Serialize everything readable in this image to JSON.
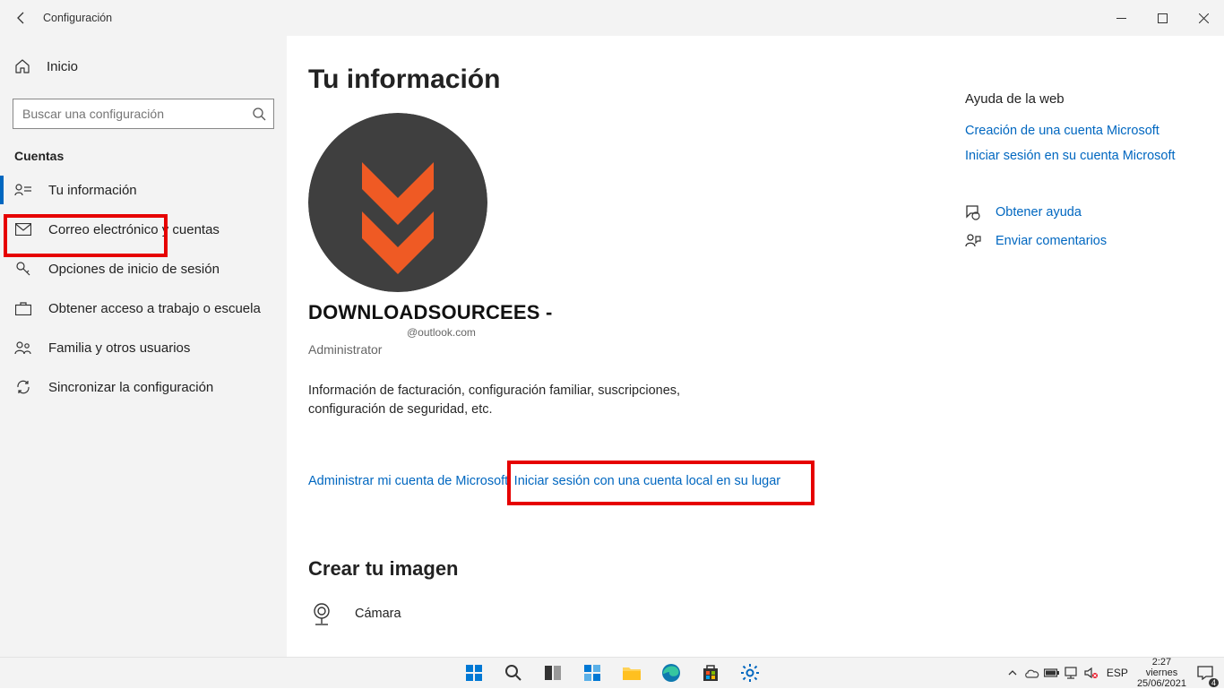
{
  "titlebar": {
    "title": "Configuración"
  },
  "sidebar": {
    "home": "Inicio",
    "search_placeholder": "Buscar una configuración",
    "section": "Cuentas",
    "items": [
      {
        "label": "Tu información"
      },
      {
        "label": "Correo electrónico y cuentas"
      },
      {
        "label": "Opciones de inicio de sesión"
      },
      {
        "label": "Obtener acceso a trabajo o escuela"
      },
      {
        "label": "Familia y otros usuarios"
      },
      {
        "label": "Sincronizar la configuración"
      }
    ]
  },
  "main": {
    "title": "Tu información",
    "account_name": "DOWNLOADSOURCEES -",
    "account_email": "@outlook.com",
    "account_role": "Administrator",
    "desc": "Información de facturación, configuración familiar, suscripciones, configuración de seguridad, etc.",
    "manage_link": "Administrar mi cuenta de Microsoft",
    "local_link": "Iniciar sesión con una cuenta local en su lugar",
    "create_image": "Crear tu imagen",
    "camera": "Cámara"
  },
  "rightcol": {
    "title": "Ayuda de la web",
    "links": [
      "Creación de una cuenta Microsoft",
      "Iniciar sesión en su cuenta Microsoft"
    ],
    "help": "Obtener ayuda",
    "feedback": "Enviar comentarios"
  },
  "taskbar": {
    "lang": "ESP",
    "time": "2:27",
    "day": "viernes",
    "date": "25/06/2021",
    "notif_count": "4"
  }
}
